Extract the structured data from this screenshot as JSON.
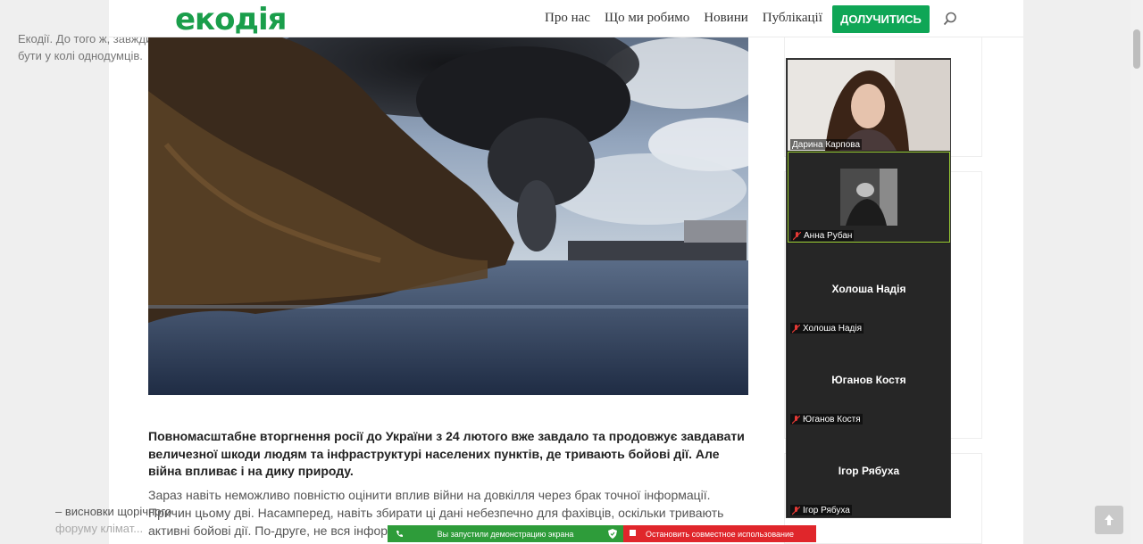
{
  "header": {
    "logo": "екодія",
    "nav": [
      "Про нас",
      "Що ми робимо",
      "Новини",
      "Публікації"
    ],
    "join_button": "ДОЛУЧИТИСЬ"
  },
  "article": {
    "lead": "Повномасштабне вторгнення росії до України з 24 лютого вже завдало та продовжує завдавати величезної шкоди людям та інфраструктурі населених пунктів, де тривають бойові дії. Але війна впливає і на дику природу.",
    "body": "Зараз навіть неможливо повністю оцінити вплив війни на довкілля через брак точної інформації. Причин цьому дві. Насамперед, навіть збирати ці дані небезпечно для фахівців, оскільки тривають активні бойові дії. По-друге, не вся інформація може бути"
  },
  "sidebar": {
    "widget1_text": [
      "Екодії. До того ж, завжди круто",
      "бути у колі однодумців."
    ],
    "widget3_text": [
      "– висновки щорічного",
      "форуму клімат..."
    ]
  },
  "video_call": {
    "participants": [
      {
        "name": "Дарина Карпова",
        "video": true
      },
      {
        "name": "Анна Рубан",
        "video": true,
        "muted": true,
        "active": true
      },
      {
        "name": "Холоша Надія",
        "video": false,
        "muted": true
      },
      {
        "name": "Юганов Костя",
        "video": false,
        "muted": true
      },
      {
        "name": "Ігор Рябуха",
        "video": false,
        "muted": true
      }
    ]
  },
  "screen_share": {
    "status": "Вы запустили демонстрацию экрана",
    "stop": "Остановить совместное использование"
  },
  "colors": {
    "brand_green": "#1a9e4b",
    "button_green": "#0fa656",
    "share_green": "#2e9c3a",
    "share_red": "#e0262b"
  }
}
